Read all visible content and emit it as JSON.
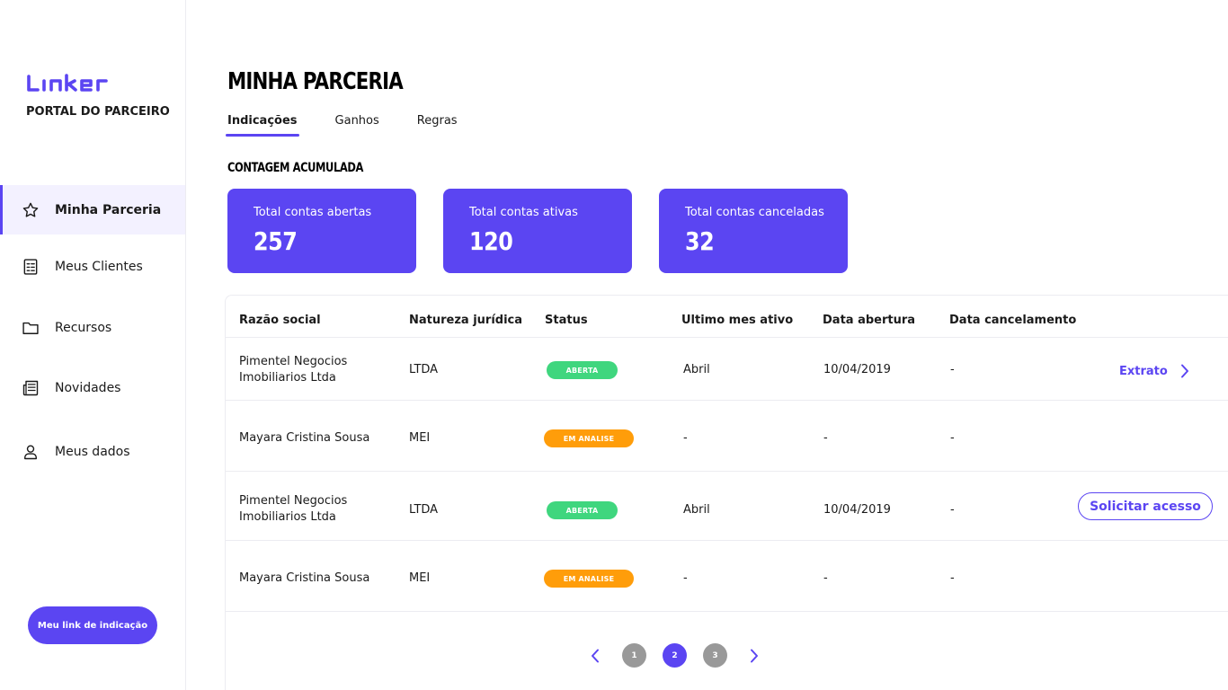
{
  "brand": {
    "logo_text": "Linker",
    "portal_label": "PORTAL DO PARCEIRO",
    "accent_color": "#5b45f2"
  },
  "sidebar": {
    "items": [
      {
        "label": "Minha Parceria",
        "icon": "star-icon",
        "active": true
      },
      {
        "label": "Meus Clientes",
        "icon": "client-list-icon",
        "active": false
      },
      {
        "label": "Recursos",
        "icon": "folder-icon",
        "active": false
      },
      {
        "label": "Novidades",
        "icon": "newspaper-icon",
        "active": false
      },
      {
        "label": "Meus dados",
        "icon": "user-icon",
        "active": false
      }
    ],
    "referral_button": "Meu link de indicação"
  },
  "main": {
    "title": "MINHA PARCERIA",
    "tabs": [
      {
        "label": "Indicações",
        "active": true
      },
      {
        "label": "Ganhos",
        "active": false
      },
      {
        "label": "Regras",
        "active": false
      }
    ],
    "section_title": "CONTAGEM ACUMULADA",
    "cards": [
      {
        "label": "Total contas abertas",
        "value": "257"
      },
      {
        "label": "Total contas ativas",
        "value": "120"
      },
      {
        "label": "Total contas canceladas",
        "value": "32"
      }
    ]
  },
  "table": {
    "headers": [
      "Razão social",
      "Natureza jurídica",
      "Status",
      "Ultimo mes ativo",
      "Data abertura",
      "Data cancelamento"
    ],
    "rows": [
      {
        "razao_l1": "Pimentel Negocios",
        "razao_l2": "Imobiliarios Ltda",
        "natureza": "LTDA",
        "status": "ABERTA",
        "status_color": "#3fd67e",
        "ultimo_mes": "Abril",
        "abertura": "10/04/2019",
        "cancelamento": "-",
        "action": "Extrato"
      },
      {
        "razao_l1": "Mayara Cristina Sousa",
        "razao_l2": "",
        "natureza": "MEI",
        "status": "EM ANALISE",
        "status_color": "#ff9d0a",
        "ultimo_mes": "-",
        "abertura": "-",
        "cancelamento": "-",
        "action": ""
      },
      {
        "razao_l1": "Pimentel Negocios",
        "razao_l2": "Imobiliarios Ltda",
        "natureza": "LTDA",
        "status": "ABERTA",
        "status_color": "#3fd67e",
        "ultimo_mes": "Abril",
        "abertura": "10/04/2019",
        "cancelamento": "-",
        "action": "Solicitar acesso"
      },
      {
        "razao_l1": "Mayara Cristina Sousa",
        "razao_l2": "",
        "natureza": "MEI",
        "status": "EM ANALISE",
        "status_color": "#ff9d0a",
        "ultimo_mes": "-",
        "abertura": "-",
        "cancelamento": "-",
        "action": ""
      }
    ]
  },
  "pagination": {
    "pages": [
      "1",
      "2",
      "3"
    ],
    "current": "2"
  }
}
